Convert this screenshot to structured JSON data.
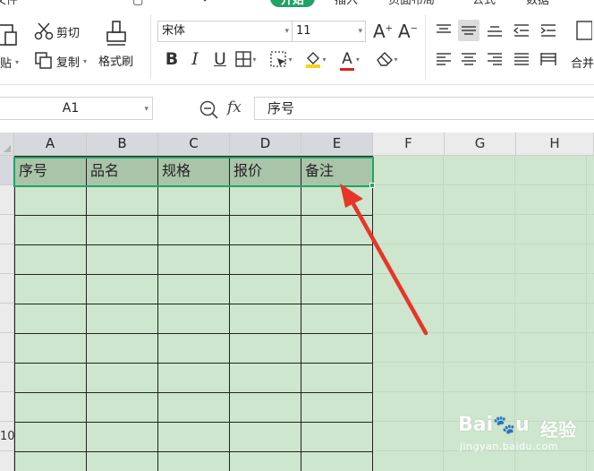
{
  "tabs": {
    "file": "文件",
    "home": "开始",
    "insert": "插入",
    "page_layout": "页面布局",
    "formulas": "公式",
    "data": "数据"
  },
  "clipboard": {
    "paste": "粘贴",
    "cut": "剪切",
    "copy": "复制",
    "format_painter": "格式刷"
  },
  "font": {
    "family": "宋体",
    "size": "11",
    "bold": "B",
    "italic": "I",
    "underline": "U",
    "font_color_letter": "A",
    "colors": {
      "fill": "#f5d31b",
      "font": "#e0201f"
    }
  },
  "alignment": {
    "merge": "合并"
  },
  "formula_bar": {
    "name_box": "A1",
    "fx": "fx",
    "value": "序号"
  },
  "sheet": {
    "columns": [
      "A",
      "B",
      "C",
      "D",
      "E",
      "F",
      "G",
      "H"
    ],
    "row_numbers": [
      "",
      "",
      "",
      "",
      "",
      "",
      "",
      "",
      "",
      "10",
      ""
    ],
    "header_row": [
      "序号",
      "品名",
      "规格",
      "报价",
      "备注"
    ]
  },
  "watermark": {
    "logo": "Bai",
    "logo_tail": "经验",
    "url": "jingyan.baidu.com"
  },
  "colors": {
    "accent": "#21a366",
    "sheet_bg": "#cde6cd",
    "header_fill": "#a9c4a9",
    "arrow": "#e8352a"
  }
}
